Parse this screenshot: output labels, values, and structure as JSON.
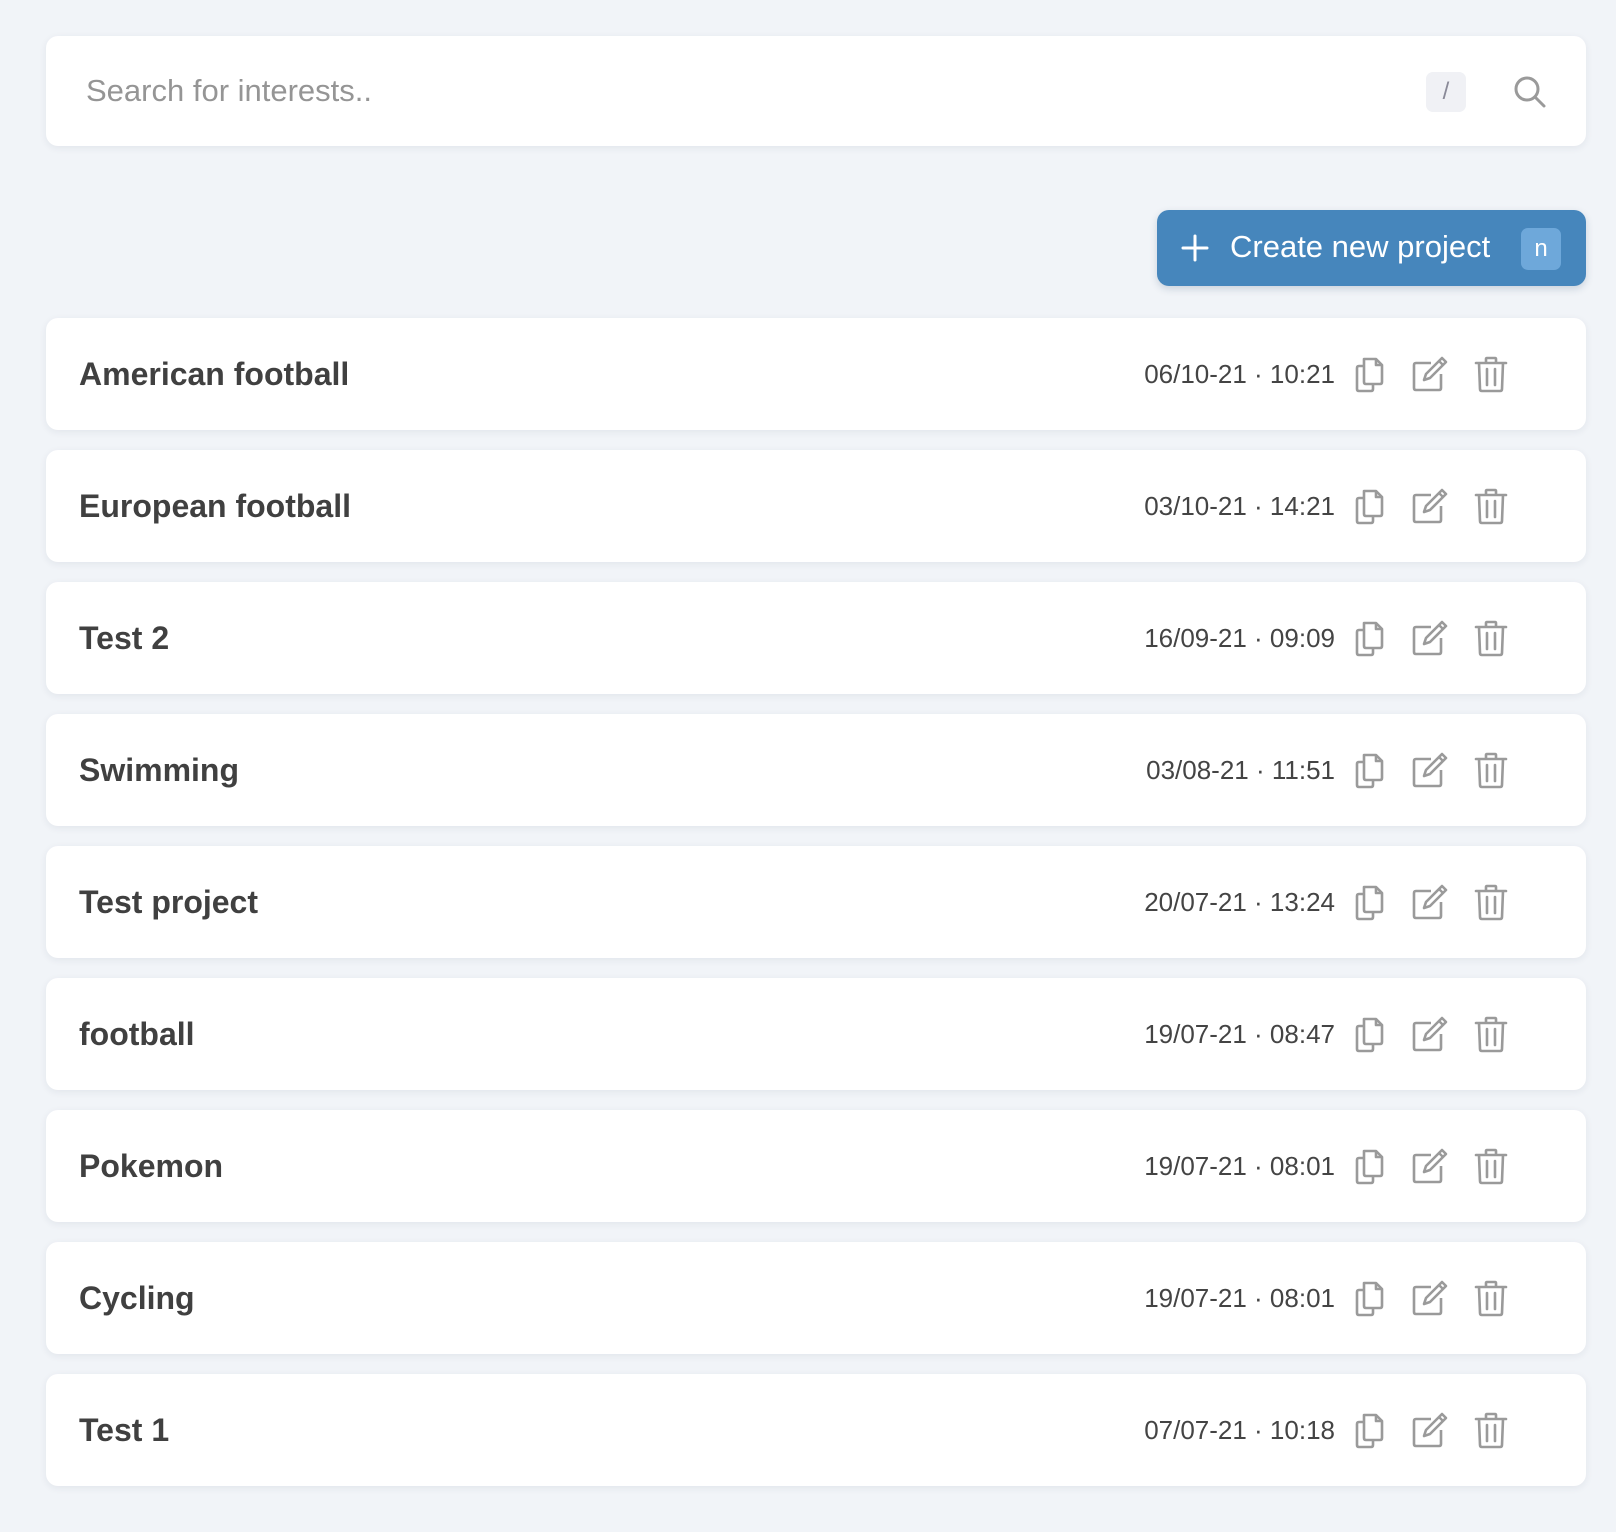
{
  "search": {
    "placeholder": "Search for interests..",
    "value": "",
    "shortcut_key": "/",
    "icon": "search-icon"
  },
  "create_button": {
    "label": "Create new project",
    "shortcut_key": "n",
    "icon": "plus-icon",
    "color": "#4686bc"
  },
  "projects": [
    {
      "title": "American football",
      "date": "06/10-21 · 10:21"
    },
    {
      "title": "European football",
      "date": "03/10-21 · 14:21"
    },
    {
      "title": "Test 2",
      "date": "16/09-21 · 09:09"
    },
    {
      "title": "Swimming",
      "date": "03/08-21 · 11:51"
    },
    {
      "title": "Test project",
      "date": "20/07-21 · 13:24"
    },
    {
      "title": "football",
      "date": "19/07-21 · 08:47"
    },
    {
      "title": "Pokemon",
      "date": "19/07-21 · 08:01"
    },
    {
      "title": "Cycling",
      "date": "19/07-21 · 08:01"
    },
    {
      "title": "Test 1",
      "date": "07/07-21 · 10:18"
    }
  ],
  "row_actions": [
    "copy-icon",
    "edit-icon",
    "trash-icon"
  ],
  "colors": {
    "background": "#f1f4f8",
    "card": "#ffffff",
    "icon_gray": "#9a9a9a",
    "title_text": "#404040"
  }
}
